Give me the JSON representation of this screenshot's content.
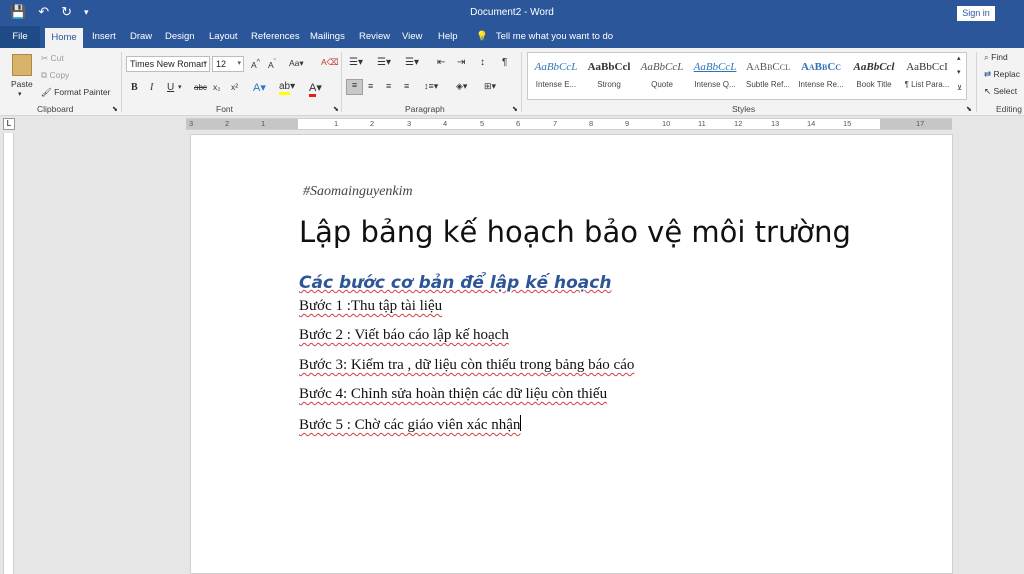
{
  "titlebar": {
    "document_title": "Document2 - Word",
    "signin": "Sign in",
    "qat": [
      "💾",
      "↶",
      "↻",
      "▾"
    ]
  },
  "tabs": [
    {
      "label": "File"
    },
    {
      "label": "Home"
    },
    {
      "label": "Insert"
    },
    {
      "label": "Draw"
    },
    {
      "label": "Design"
    },
    {
      "label": "Layout"
    },
    {
      "label": "References"
    },
    {
      "label": "Mailings"
    },
    {
      "label": "Review"
    },
    {
      "label": "View"
    },
    {
      "label": "Help"
    }
  ],
  "tellme": {
    "text": "Tell me what you want to do"
  },
  "clipboard": {
    "paste": "Paste",
    "cut": "Cut",
    "copy": "Copy",
    "format_painter": "Format Painter",
    "label": "Clipboard"
  },
  "font": {
    "family": "Times New Roman",
    "size": "12",
    "label": "Font",
    "buttons": [
      "B",
      "I",
      "U",
      "abc",
      "x₂",
      "x²"
    ]
  },
  "paragraph": {
    "label": "Paragraph"
  },
  "styles": {
    "label": "Styles",
    "items": [
      {
        "sample": "AaBbCcL",
        "name": "Intense E..."
      },
      {
        "sample": "AaBbCcl",
        "name": "Strong"
      },
      {
        "sample": "AaBbCcL",
        "name": "Quote"
      },
      {
        "sample": "AaBbCcL",
        "name": "Intense Q..."
      },
      {
        "sample": "AaBbCcl",
        "name": "Subtle Ref..."
      },
      {
        "sample": "AaBbCc",
        "name": "Intense Re..."
      },
      {
        "sample": "AaBbCcl",
        "name": "Book Title"
      },
      {
        "sample": "AaBbCcI",
        "name": "¶ List Para..."
      }
    ]
  },
  "editing": {
    "find": "Find",
    "replace": "Replac",
    "select": "Select",
    "label": "Editing"
  },
  "ruler_numbers": [
    "3",
    "2",
    "1",
    "1",
    "2",
    "3",
    "4",
    "5",
    "6",
    "7",
    "8",
    "9",
    "10",
    "11",
    "12",
    "13",
    "14",
    "15",
    "17"
  ],
  "document": {
    "hashtag": "#Saomainguyenkim",
    "title": "Lập bảng kế hoạch bảo vệ môi trường",
    "subtitle": "Các bước  cơ bản để lập kế hoạch",
    "steps": [
      "Bước 1 :Thu tập tài liệu",
      "Bước 2 : Viết báo cáo lập kế hoạch",
      "Bước 3: Kiểm tra , dữ liệu còn thiếu trong bảng báo cáo",
      "Bước 4: Chỉnh sửa hoàn thiện các dữ liệu còn thiếu",
      "Bước 5 : Chờ các giáo viên xác nhận"
    ]
  }
}
